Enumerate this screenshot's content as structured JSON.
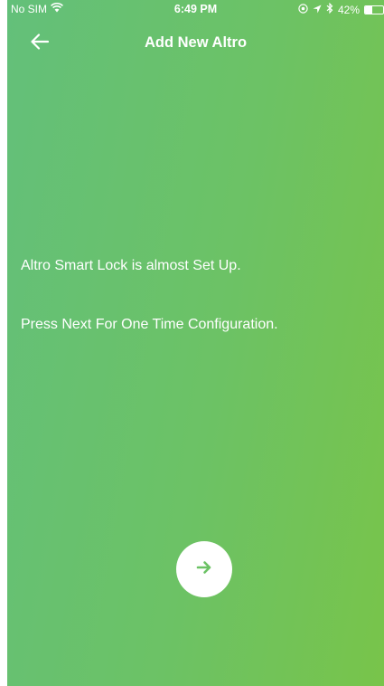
{
  "status_bar": {
    "carrier": "No SIM",
    "time": "6:49 PM",
    "battery_percent": "42%",
    "battery_level": 0.42,
    "icons": [
      "wifi-icon",
      "at-icon",
      "location-icon",
      "bluetooth-icon",
      "battery-icon"
    ]
  },
  "nav": {
    "title": "Add New Altro",
    "back_icon": "arrow-left-icon"
  },
  "content": {
    "line1": "Altro Smart Lock is almost Set Up.",
    "line2": "Press Next For One Time Configuration."
  },
  "next_button": {
    "icon": "arrow-right-icon"
  },
  "colors": {
    "gradient_start": "#63c07a",
    "gradient_end": "#78c44a",
    "accent": "#6cc265",
    "text": "#ffffff"
  }
}
